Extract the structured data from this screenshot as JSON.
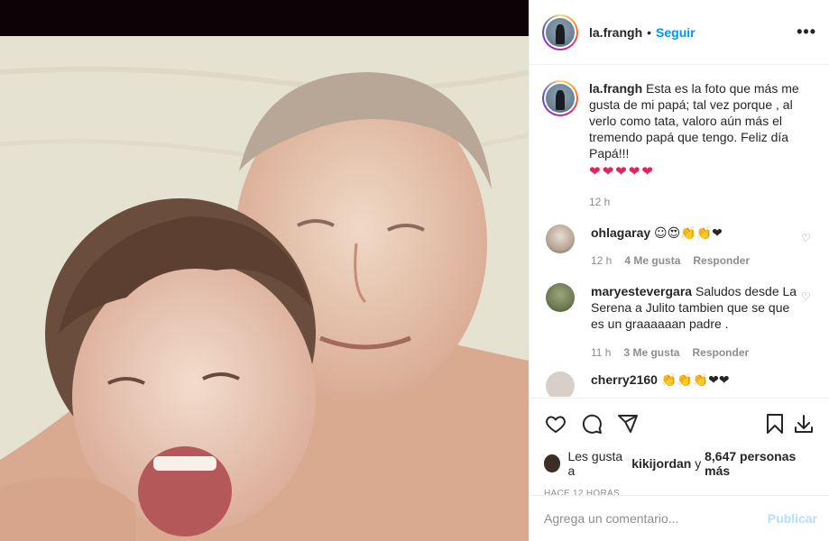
{
  "post": {
    "username": "la.frangh",
    "separator": "•",
    "follow_label": "Seguir",
    "more_label": "•••",
    "photo_alt": "photo"
  },
  "caption": {
    "username": "la.frangh",
    "text": "Esta es la foto que más me gusta de mi papá; tal vez porque , al verlo como tata, valoro aún más el tremendo papá que tengo. Feliz día Papá!!!",
    "hearts": "❤❤❤❤❤",
    "time": "12 h"
  },
  "comments": [
    {
      "username": "ohlagaray",
      "text": "☺😍👏👏❤",
      "time": "12 h",
      "likes": "4 Me gusta",
      "reply": "Responder"
    },
    {
      "username": "maryestevergara",
      "text": "Saludos desde La Serena a Julito tambien que se que es un graaaaaan padre .",
      "time": "11 h",
      "likes": "3 Me gusta",
      "reply": "Responder"
    },
    {
      "username": "cherry2160",
      "text": "👏👏👏❤❤"
    }
  ],
  "actions": {
    "likes_prefix": "Les gusta a",
    "likes_user": "kikijordan",
    "likes_middle": "y",
    "likes_count": "8,647 personas más",
    "timestamp": "HACE 12 HORAS"
  },
  "add_comment": {
    "placeholder": "Agrega un comentario...",
    "publish_label": "Publicar"
  },
  "colors": {
    "accent": "#0095f6",
    "publish_disabled": "#b2dffc",
    "heart": "#e0245e",
    "muted": "#8e8e8e",
    "text": "#262626"
  },
  "icons": [
    "heart-icon",
    "comment-icon",
    "share-icon",
    "bookmark-icon",
    "download-icon",
    "more-icon"
  ]
}
